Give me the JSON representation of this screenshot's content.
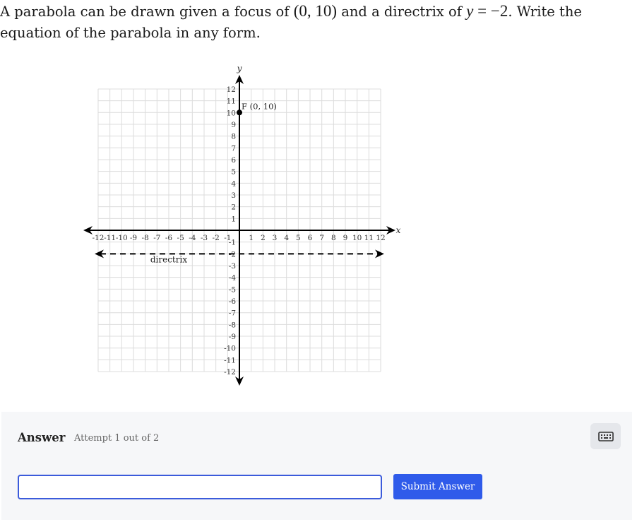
{
  "question": {
    "text_1": "A parabola can be drawn given a focus of ",
    "focus_math": "(0, 10)",
    "text_2": " and a directrix of ",
    "directrix_var": "y",
    "directrix_rest": " = −2",
    "text_3": ". Write the equation of the parabola in any form."
  },
  "graph": {
    "x_axis_label": "x",
    "y_axis_label": "y",
    "x_min": -12,
    "x_max": 12,
    "y_min": -12,
    "y_max": 12,
    "grid": true,
    "focus_point": {
      "x": 0,
      "y": 10,
      "label": "F (0, 10)"
    },
    "directrix": {
      "y": -2,
      "label": "directrix",
      "style": "dashed"
    },
    "colors": {
      "grid": "#dcdcdc",
      "axis": "#000000"
    }
  },
  "answer": {
    "title": "Answer",
    "attempt_text": "Attempt 1 out of 2",
    "input_value": "",
    "input_placeholder": "",
    "submit_label": "Submit Answer",
    "keyboard_icon": "keyboard-icon",
    "accent_color": "#2f5bea"
  }
}
